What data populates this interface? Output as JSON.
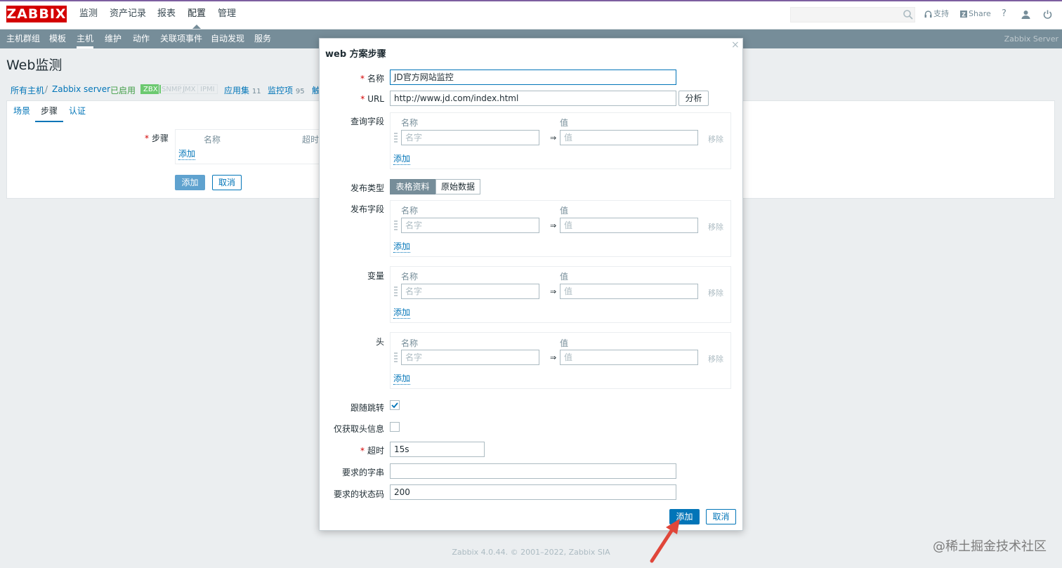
{
  "topnav": {
    "logo": "ZABBIX",
    "menu": [
      "监测",
      "资产记录",
      "报表",
      "配置",
      "管理"
    ],
    "support": "支持",
    "share": "Share",
    "help": "?"
  },
  "subnav": {
    "items": [
      "主机群组",
      "模板",
      "主机",
      "维护",
      "动作",
      "关联项事件",
      "自动发现",
      "服务"
    ],
    "server": "Zabbix Server"
  },
  "page": {
    "title": "Web监测",
    "breadcrumb": {
      "all_hosts": "所有主机",
      "sep": "/",
      "host": "Zabbix server",
      "enabled": "已启用",
      "tags": [
        "ZBX",
        "SNMP",
        "JMX",
        "IPMI"
      ],
      "apps": "应用集",
      "apps_count": "11",
      "items": "监控项",
      "items_count": "95",
      "triggers": "触"
    },
    "tabs": [
      "场景",
      "步骤",
      "认证"
    ],
    "steps_label": "步骤",
    "steps_col_name": "名称",
    "steps_col_timeout": "超时",
    "steps_add": "添加",
    "add_button": "添加",
    "cancel_button": "取消"
  },
  "dialog": {
    "title": "web 方案步骤",
    "close": "×",
    "name_label": "名称",
    "name_value": "JD官方网站监控",
    "url_label": "URL",
    "url_value": "http://www.jd.com/index.html",
    "parse_button": "分析",
    "query_label": "查询字段",
    "post_type_label": "发布类型",
    "post_type_options": [
      "表格资料",
      "原始数据"
    ],
    "post_fields_label": "发布字段",
    "variables_label": "变量",
    "headers_label": "头",
    "col_name": "名称",
    "col_value": "值",
    "name_placeholder": "名字",
    "value_placeholder": "值",
    "eq": "⇒",
    "remove": "移除",
    "add_link": "添加",
    "follow_redirects_label": "跟随跳转",
    "follow_redirects": true,
    "headers_only_label": "仅获取头信息",
    "headers_only": false,
    "timeout_label": "超时",
    "timeout_value": "15s",
    "required_string_label": "要求的字串",
    "required_string_value": "",
    "status_codes_label": "要求的状态码",
    "status_codes_value": "200",
    "add_button": "添加",
    "cancel_button": "取消"
  },
  "footer": "Zabbix 4.0.44. © 2001–2022, Zabbix SIA",
  "watermark": "@稀土掘金技术社区",
  "colors": {
    "accent": "#0275b8",
    "subnav": "#768d99",
    "logo": "#d40000",
    "arrow": "#e0463a"
  }
}
